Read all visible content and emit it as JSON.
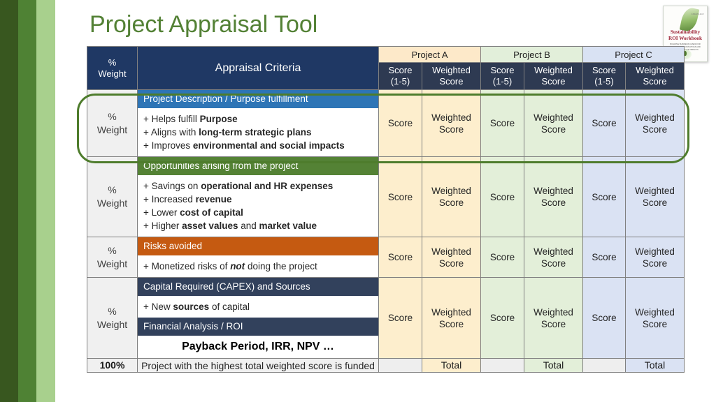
{
  "slide": {
    "title": "Project Appraisal Tool",
    "title_color": "#538135"
  },
  "book_cover": {
    "brand": "GREENLEAF",
    "title_line1": "Sustainability",
    "title_line2": "ROI Workbook",
    "subtitle": "BUILDING BUSINESS CASES FOR SUSTAINABILITY INITIATIVES AND MEASURING THEIR IMPACTS"
  },
  "table": {
    "header": {
      "weight_line1": "%",
      "weight_line2": "Weight",
      "criteria": "Appraisal Criteria",
      "projects": [
        {
          "name": "Project A",
          "tint": "#fde9c9"
        },
        {
          "name": "Project B",
          "tint": "#e2efda"
        },
        {
          "name": "Project C",
          "tint": "#d9e2f3"
        }
      ],
      "sub": {
        "score_line1": "Score",
        "score_line2": "(1-5)",
        "weighted_line1": "Weighted",
        "weighted_line2": "Score"
      }
    },
    "cell_labels": {
      "score": "Score",
      "weighted_line1": "Weighted",
      "weighted_line2": "Score",
      "total": "Total"
    },
    "rows": [
      {
        "weight_line1": "%",
        "weight_line2": "Weight",
        "band": "Project Description / Purpose fulfillment",
        "band_color": "#2e75b6",
        "bullets": [
          {
            "prefix": "+ Helps fulfill ",
            "bold": "Purpose",
            "suffix": ""
          },
          {
            "prefix": "+ Aligns with ",
            "bold": "long-term strategic plans",
            "suffix": ""
          },
          {
            "prefix": "+ Improves ",
            "bold": "environmental and social impacts",
            "suffix": ""
          }
        ],
        "highlighted": true
      },
      {
        "weight_line1": "%",
        "weight_line2": "Weight",
        "band": "Opportunities arising from the project",
        "band_color": "#548235",
        "bullets": [
          {
            "prefix": "+ Savings on ",
            "bold": "operational and HR expenses",
            "suffix": ""
          },
          {
            "prefix": "+ Increased ",
            "bold": "revenue",
            "suffix": ""
          },
          {
            "prefix": "+ Lower ",
            "bold": "cost of capital",
            "suffix": ""
          },
          {
            "prefix": "+ Higher ",
            "bold": "asset values",
            "suffix": " and ",
            "bold2": "market value"
          }
        ],
        "highlighted": false
      },
      {
        "weight_line1": "%",
        "weight_line2": "Weight",
        "band": "Risks avoided",
        "band_color": "#c55a11",
        "bullets": [
          {
            "prefix": "+ Monetized risks of ",
            "italic": "not",
            "suffix": " doing the project"
          }
        ],
        "highlighted": false
      },
      {
        "weight_line1": "%",
        "weight_line2": "Weight",
        "band": "Capital Required (CAPEX) and Sources",
        "band_color": "#32415c",
        "bullets": [
          {
            "prefix": "+ New ",
            "bold": "sources",
            "suffix": " of capital"
          }
        ],
        "band2": "Financial Analysis / ROI",
        "band2_color": "#32415c",
        "emphasis": "Payback Period, IRR, NPV …",
        "highlighted": false
      }
    ],
    "total_row": {
      "weight": "100%",
      "criteria": "Project with the highest total weighted score is funded",
      "total_label": "Total"
    }
  }
}
